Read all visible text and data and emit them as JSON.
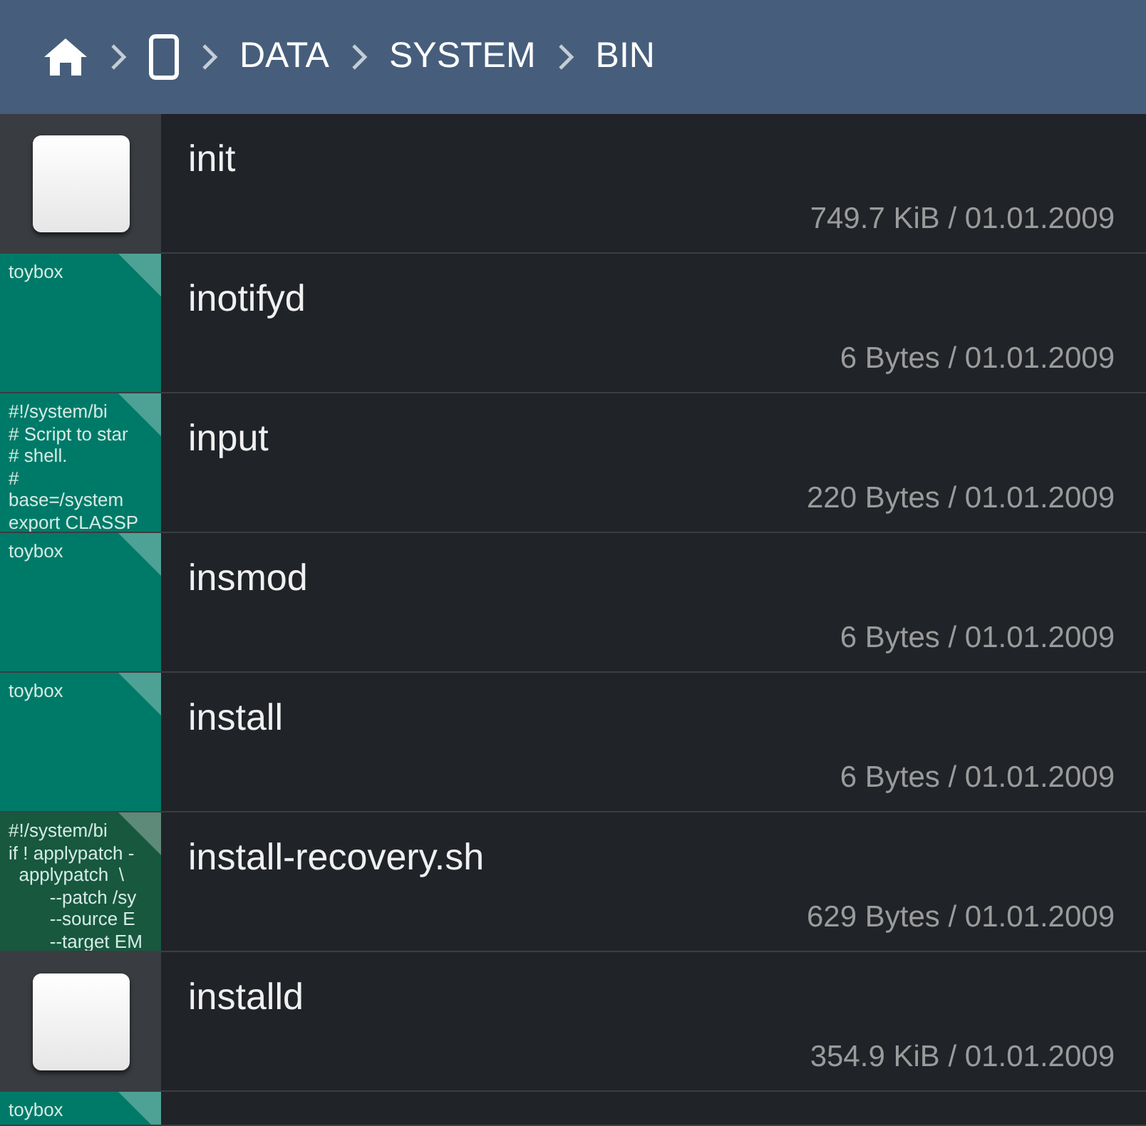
{
  "breadcrumbs": [
    {
      "kind": "home"
    },
    {
      "kind": "device"
    },
    {
      "kind": "text",
      "label": "DATA"
    },
    {
      "kind": "text",
      "label": "SYSTEM"
    },
    {
      "kind": "text",
      "label": "BIN"
    }
  ],
  "files": [
    {
      "name": "init",
      "meta": "749.7 KiB / 01.01.2009",
      "thumb": {
        "kind": "binary"
      }
    },
    {
      "name": "inotifyd",
      "meta": "6 Bytes / 01.01.2009",
      "thumb": {
        "kind": "text",
        "color": "#007a68",
        "lines": [
          "toybox"
        ]
      }
    },
    {
      "name": "input",
      "meta": "220 Bytes / 01.01.2009",
      "thumb": {
        "kind": "text",
        "color": "#007a68",
        "lines": [
          "#!/system/bi",
          "# Script to star",
          "# shell.",
          "#",
          "base=/system",
          "export CLASSP"
        ]
      }
    },
    {
      "name": "insmod",
      "meta": "6 Bytes / 01.01.2009",
      "thumb": {
        "kind": "text",
        "color": "#007a68",
        "lines": [
          "toybox"
        ]
      }
    },
    {
      "name": "install",
      "meta": "6 Bytes / 01.01.2009",
      "thumb": {
        "kind": "text",
        "color": "#007a68",
        "lines": [
          "toybox"
        ]
      }
    },
    {
      "name": "install-recovery.sh",
      "meta": "629 Bytes / 01.01.2009",
      "thumb": {
        "kind": "text",
        "color": "#17583f",
        "lines": [
          "#!/system/bi",
          "if ! applypatch -",
          "  applypatch  \\",
          "        --patch /sy",
          "        --source E",
          "        --target EM"
        ]
      }
    },
    {
      "name": "installd",
      "meta": "354.9 KiB / 01.01.2009",
      "thumb": {
        "kind": "binary"
      }
    },
    {
      "thumb": {
        "kind": "text",
        "color": "#007a68",
        "lines": [
          "toybox"
        ]
      }
    }
  ]
}
